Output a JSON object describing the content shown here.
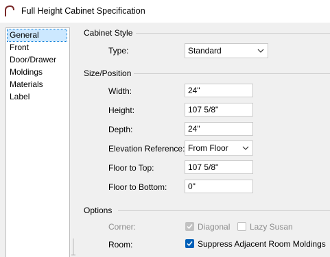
{
  "window": {
    "title": "Full Height Cabinet Specification"
  },
  "sidebar": {
    "items": [
      {
        "label": "General",
        "selected": true
      },
      {
        "label": "Front"
      },
      {
        "label": "Door/Drawer"
      },
      {
        "label": "Moldings"
      },
      {
        "label": "Materials"
      },
      {
        "label": "Label"
      }
    ]
  },
  "cabinet_style": {
    "title": "Cabinet Style",
    "type_label": "Type:",
    "type_value": "Standard"
  },
  "size_position": {
    "title": "Size/Position",
    "width_label": "Width:",
    "width_value": "24\"",
    "height_label": "Height:",
    "height_value": "107 5/8\"",
    "depth_label": "Depth:",
    "depth_value": "24\"",
    "elev_ref_label": "Elevation Reference:",
    "elev_ref_value": "From Floor",
    "floor_top_label": "Floor to Top:",
    "floor_top_value": "107 5/8\"",
    "floor_bottom_label": "Floor to Bottom:",
    "floor_bottom_value": "0\""
  },
  "options": {
    "title": "Options",
    "corner_label": "Corner:",
    "diagonal_label": "Diagonal",
    "lazy_susan_label": "Lazy Susan",
    "room_label": "Room:",
    "suppress_label": "Suppress Adjacent Room Moldings"
  },
  "colors": {
    "accent": "#005fb8",
    "selection": "#cce8ff",
    "disabled_text": "#8d8d8d"
  },
  "icons": {
    "app": "cabinet-arc-icon",
    "dropdown": "chevron-down-icon",
    "check": "checkmark-icon"
  }
}
